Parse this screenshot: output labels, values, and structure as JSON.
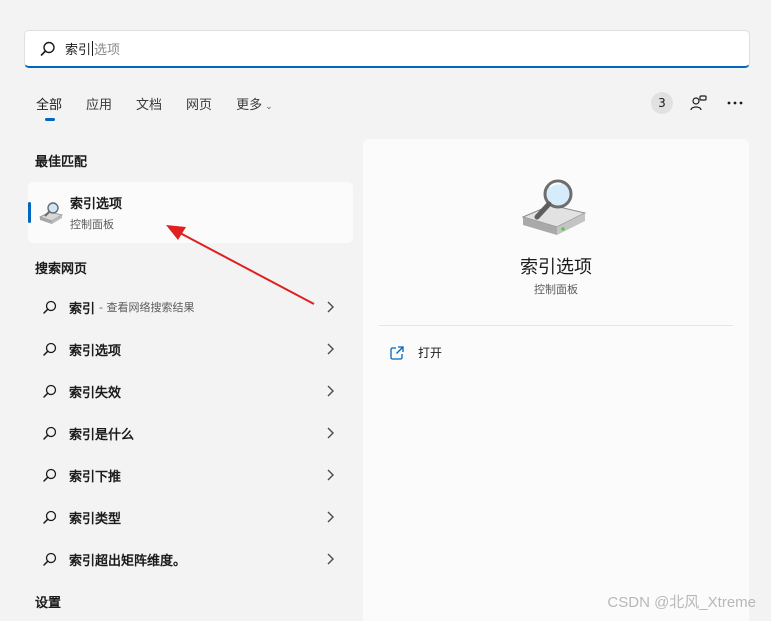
{
  "search": {
    "typed": "索引",
    "suggestion": "选项"
  },
  "tabs": [
    {
      "label": "全部"
    },
    {
      "label": "应用"
    },
    {
      "label": "文档"
    },
    {
      "label": "网页"
    },
    {
      "label": "更多"
    }
  ],
  "toolbar": {
    "count": "3",
    "account_icon": "account-switch-icon",
    "more_icon": "ellipsis-icon"
  },
  "sections": {
    "best_match": "最佳匹配",
    "web_search": "搜索网页",
    "settings": "设置"
  },
  "best_match": {
    "title": "索引选项",
    "subtitle": "控制面板",
    "icon": "indexing-options-icon"
  },
  "web_items": [
    {
      "label": "索引",
      "suffix": "- 查看网络搜索结果"
    },
    {
      "label": "索引选项",
      "suffix": ""
    },
    {
      "label": "索引失效",
      "suffix": ""
    },
    {
      "label": "索引是什么",
      "suffix": ""
    },
    {
      "label": "索引下推",
      "suffix": ""
    },
    {
      "label": "索引类型",
      "suffix": ""
    },
    {
      "label": "索引超出矩阵维度。",
      "suffix": ""
    }
  ],
  "preview": {
    "title": "索引选项",
    "subtitle": "控制面板",
    "open_label": "打开"
  },
  "watermark": "CSDN @北风_Xtreme",
  "colors": {
    "accent": "#0067c0",
    "annotation_arrow": "#e02020"
  }
}
